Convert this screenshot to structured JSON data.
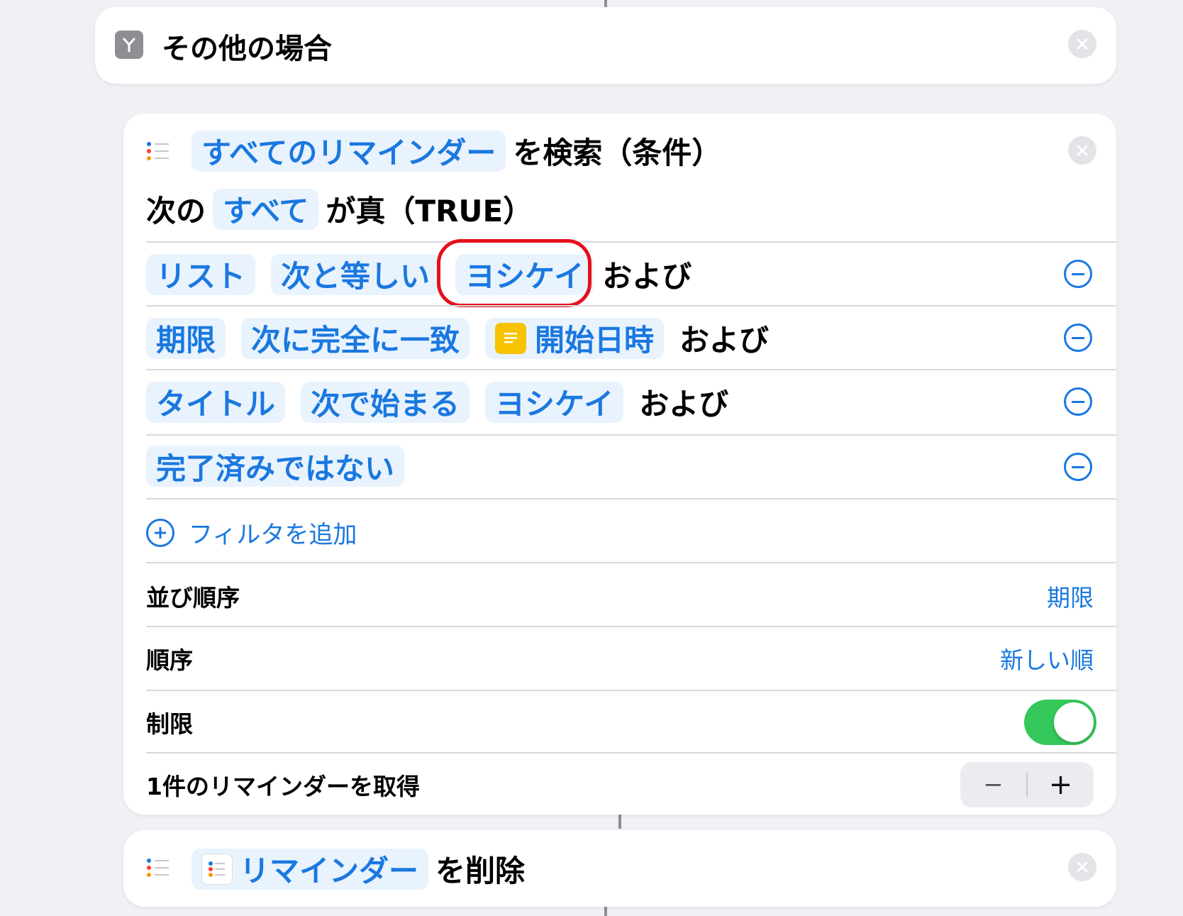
{
  "otherwise_block": {
    "title": "その他の場合",
    "icon": "branch-icon"
  },
  "find_block": {
    "source_token": "すべてのリマインダー",
    "title_suffix": "を検索（条件）",
    "match_prefix": "次の",
    "match_token": "すべて",
    "match_suffix": "が真（TRUE）",
    "filters": [
      {
        "tokens": [
          "リスト",
          "次と等しい",
          "ヨシケイ"
        ],
        "suffix": "および"
      },
      {
        "tokens": [
          "期限",
          "次に完全に一致",
          "開始日時"
        ],
        "suffix": "および",
        "variable_icon": "text-variable-icon"
      },
      {
        "tokens": [
          "タイトル",
          "次で始まる",
          "ヨシケイ"
        ],
        "suffix": "および"
      },
      {
        "tokens": [
          "完了済みではない"
        ],
        "suffix": ""
      }
    ],
    "add_filter_label": "フィルタを追加",
    "settings": {
      "sort_label": "並び順序",
      "sort_value": "期限",
      "order_label": "順序",
      "order_value": "新しい順",
      "limit_label": "制限",
      "limit_enabled": true,
      "get_label": "1件のリマインダーを取得",
      "stepper_minus": "−",
      "stepper_plus": "+"
    }
  },
  "delete_block": {
    "token": "リマインダー",
    "suffix": "を削除"
  },
  "colors": {
    "accent": "#1a78e0",
    "token_bg": "#e9f3fd",
    "toggle_on": "#34c759",
    "highlight": "#e5101b",
    "variable_icon": "#f7c300"
  }
}
